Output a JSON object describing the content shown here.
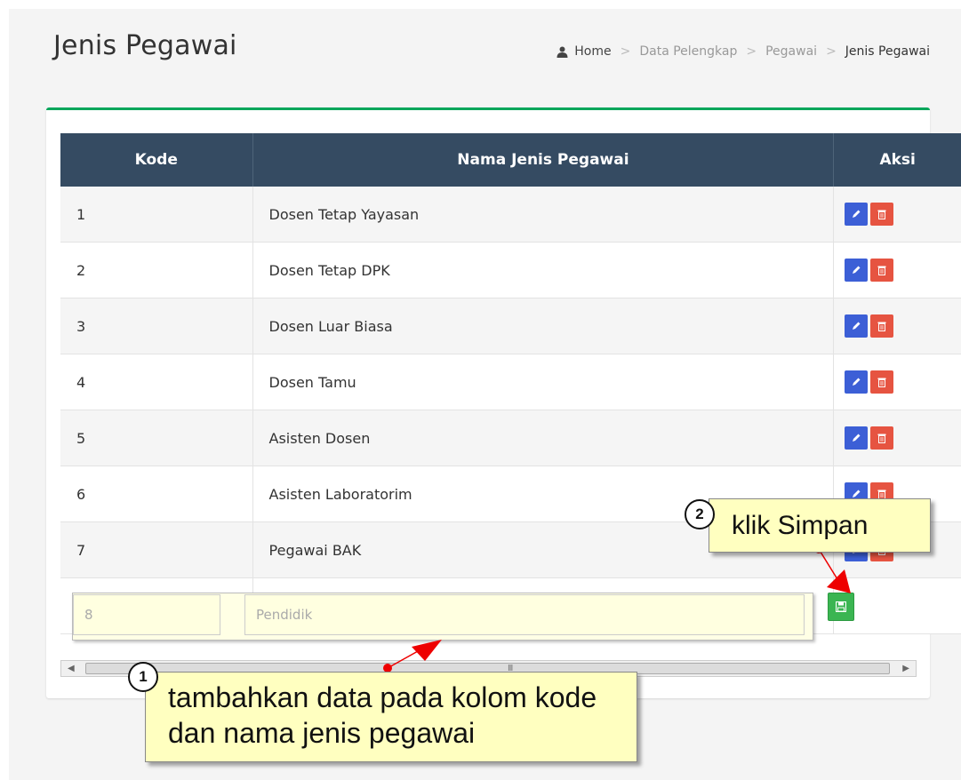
{
  "header": {
    "title": "Jenis Pegawai",
    "breadcrumb": [
      "Home",
      "Data Pelengkap",
      "Pegawai",
      "Jenis Pegawai"
    ],
    "breadcrumb_separator": ">"
  },
  "table": {
    "columns": [
      "Kode",
      "Nama Jenis Pegawai",
      "Aksi"
    ],
    "rows": [
      {
        "kode": "1",
        "nama": "Dosen Tetap Yayasan"
      },
      {
        "kode": "2",
        "nama": "Dosen Tetap DPK"
      },
      {
        "kode": "3",
        "nama": "Dosen Luar Biasa"
      },
      {
        "kode": "4",
        "nama": "Dosen Tamu"
      },
      {
        "kode": "5",
        "nama": "Asisten Dosen"
      },
      {
        "kode": "6",
        "nama": "Asisten Laboratorim"
      },
      {
        "kode": "7",
        "nama": "Pegawai BAK"
      }
    ],
    "new_row": {
      "kode_value": "8",
      "nama_value": "Pendidik"
    }
  },
  "scrollbar": {
    "grip": "III"
  },
  "callouts": [
    {
      "number": "2",
      "text": "klik Simpan"
    },
    {
      "number": "1",
      "text": "tambahkan data pada kolom kode dan nama jenis pegawai"
    }
  ],
  "colors": {
    "header_bg": "#354b62",
    "edit": "#3c5fd6",
    "delete": "#e65441",
    "save": "#3bb552",
    "box_accent": "#00a65a",
    "callout_bg": "#ffffc0",
    "arrow": "#ee0000"
  },
  "icons": {
    "breadcrumb_home": "user-icon",
    "edit": "pencil-icon",
    "delete": "trash-icon",
    "save": "floppy-icon"
  }
}
